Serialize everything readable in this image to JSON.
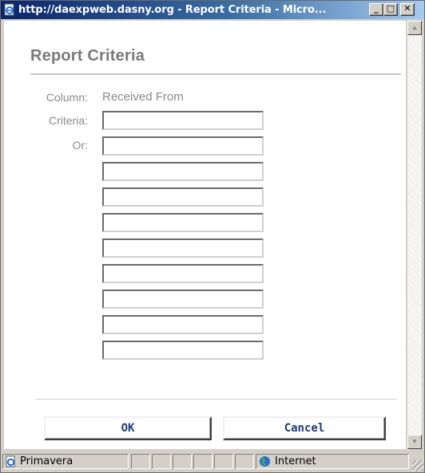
{
  "window": {
    "title": "http://daexpweb.dasny.org - Report Criteria - Micro...",
    "minimize_label": "_",
    "maximize_label": "□",
    "close_label": "✕"
  },
  "page": {
    "heading": "Report Criteria",
    "column_label": "Column:",
    "column_value": "Received From",
    "criteria_label": "Criteria:",
    "or_label": "Or:",
    "criteria_values": [
      "",
      "",
      "",
      "",
      "",
      "",
      "",
      "",
      "",
      ""
    ]
  },
  "buttons": {
    "ok": "OK",
    "cancel": "Cancel"
  },
  "statusbar": {
    "left_text": "Primavera",
    "zone_text": "Internet"
  },
  "colors": {
    "titlebar": "#0a246a",
    "heading": "#7a7a7a",
    "button_text": "#1e3c78"
  }
}
